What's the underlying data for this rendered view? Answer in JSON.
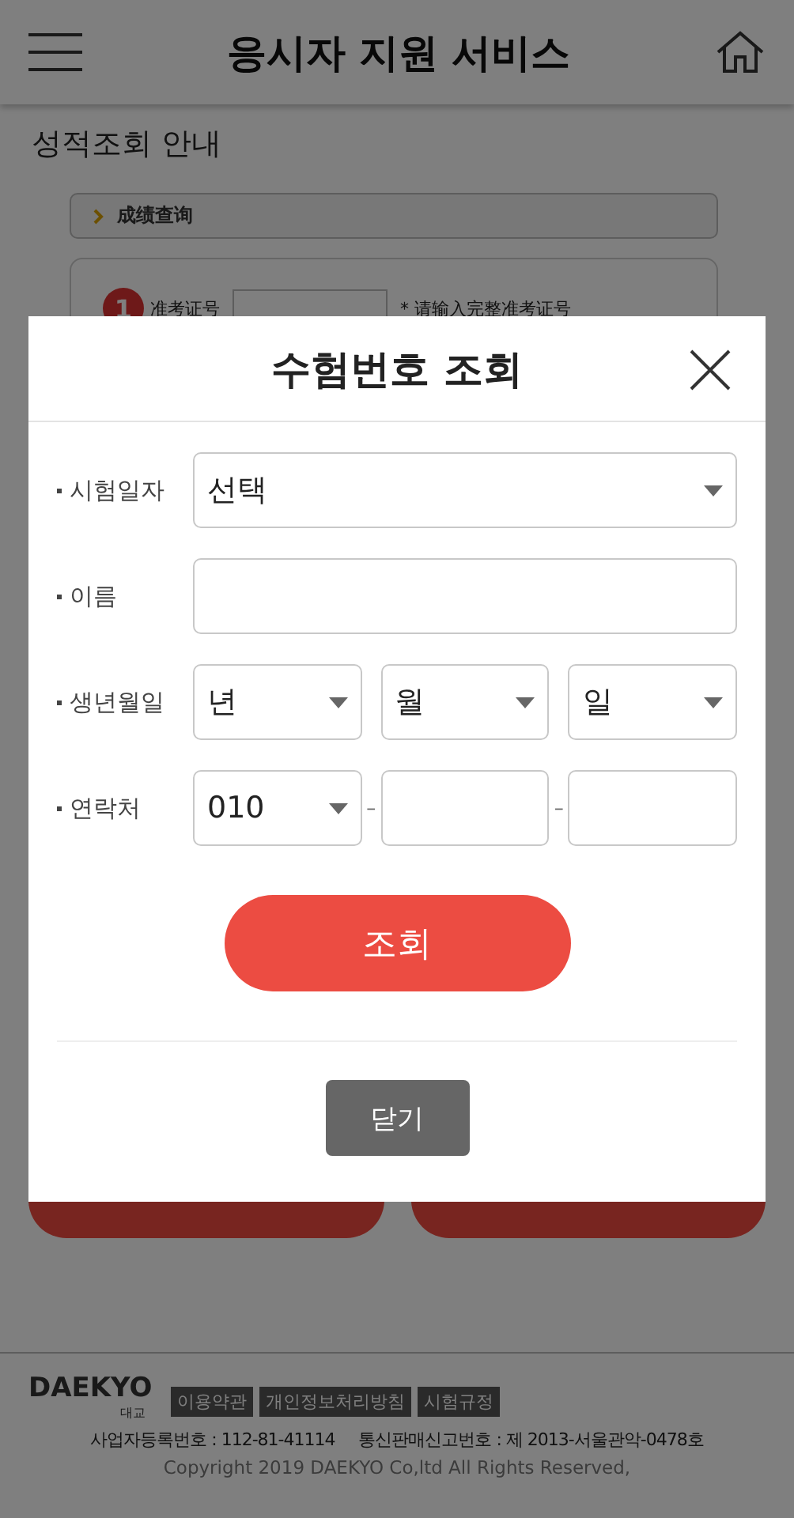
{
  "header": {
    "title": "응시자 지원 서비스"
  },
  "page": {
    "heading": "성적조회 안내",
    "tab": "成绩查询",
    "step": {
      "number": "1",
      "label": "准考证号",
      "hint": "* 请输入完整准考证号"
    }
  },
  "footer": {
    "logo": "DAEKYO",
    "logo_sub": "대교",
    "links": [
      "이용약관",
      "개인정보처리방침",
      "시험규정"
    ],
    "business": "사업자등록번호 : 112-81-41114     통신판매신고번호 : 제 2013-서울관악-0478호",
    "copyright": "Copyright 2019 DAEKYO Co,ltd All Rights Reserved,"
  },
  "modal": {
    "title": "수험번호 조회",
    "fields": [
      {
        "label": "시험일자",
        "parts": [
          {
            "kind": "select",
            "value": "선택"
          }
        ]
      },
      {
        "label": "이름",
        "parts": [
          {
            "kind": "input"
          }
        ]
      },
      {
        "label": "생년월일",
        "parts": [
          {
            "kind": "select",
            "value": "년"
          },
          {
            "kind": "select",
            "value": "월"
          },
          {
            "kind": "select",
            "value": "일"
          }
        ]
      },
      {
        "label": "연락처",
        "separator": "–",
        "parts": [
          {
            "kind": "select",
            "value": "010"
          },
          {
            "kind": "input"
          },
          {
            "kind": "input"
          }
        ]
      }
    ],
    "submit": "조회",
    "close": "닫기"
  }
}
